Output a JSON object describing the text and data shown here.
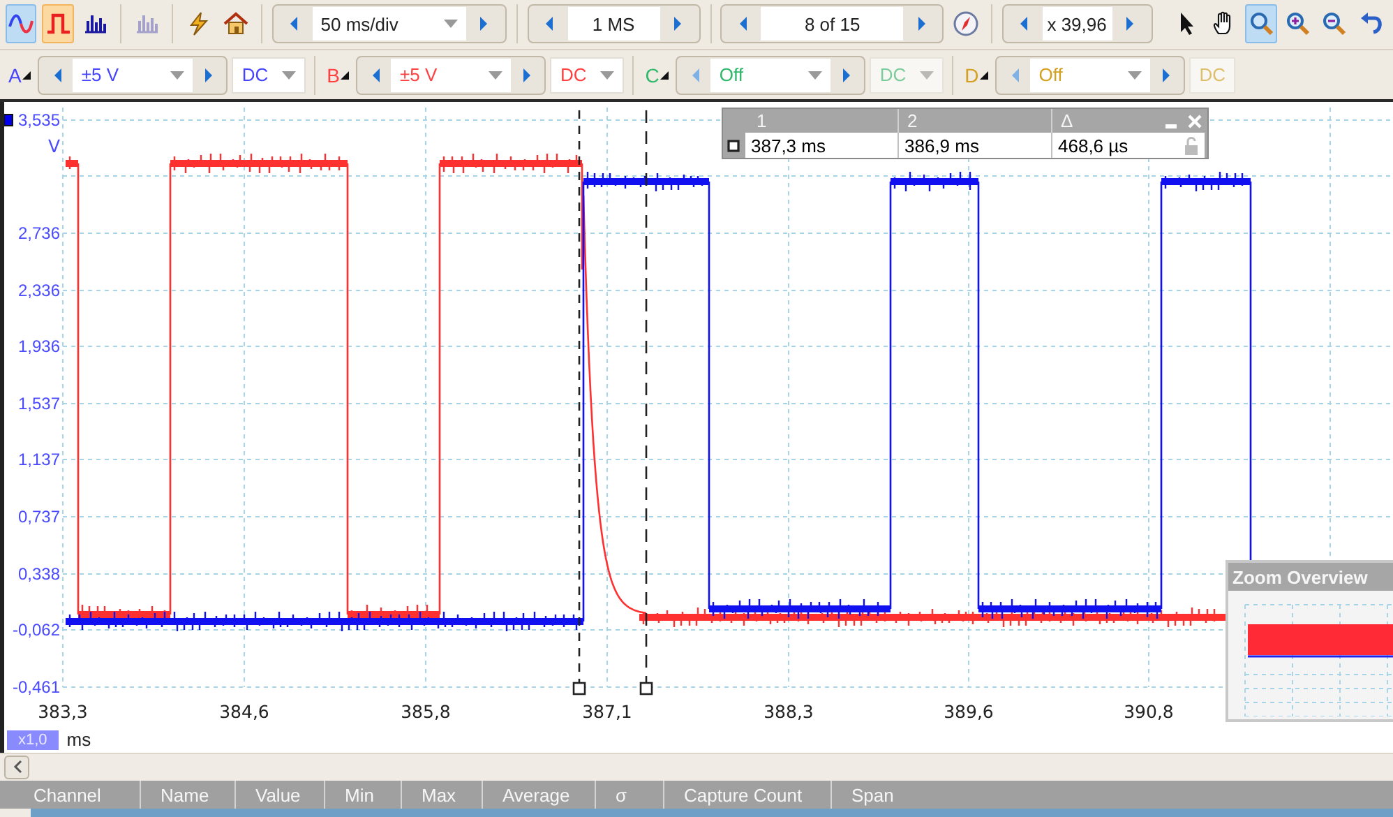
{
  "toolbar": {
    "modes": [
      {
        "kind": "scope",
        "selected": true,
        "disabled": false
      },
      {
        "kind": "persistence",
        "selected": true,
        "disabled": false
      },
      {
        "kind": "spectrum",
        "selected": false,
        "disabled": false
      },
      {
        "kind": "spectrum",
        "selected": false,
        "disabled": true
      }
    ],
    "actions": [
      {
        "kind": "trigger"
      },
      {
        "kind": "home"
      }
    ],
    "timebase": {
      "value": "50 ms/div"
    },
    "samples": {
      "value": "1 MS"
    },
    "buffer": {
      "value": "8 of 15"
    },
    "zoom_factor": {
      "value": "x 39,96"
    },
    "tools": [
      {
        "kind": "pointer",
        "selected": false
      },
      {
        "kind": "hand",
        "selected": false
      },
      {
        "kind": "zoom",
        "selected": true
      },
      {
        "kind": "zoom_in",
        "selected": false
      },
      {
        "kind": "zoom_out",
        "selected": false
      },
      {
        "kind": "undo",
        "selected": false
      }
    ]
  },
  "channels": [
    {
      "letter": "A",
      "color": "#4444ff",
      "range": "±5 V",
      "coupling": "DC",
      "enabled": true
    },
    {
      "letter": "B",
      "color": "#ff4040",
      "range": "±5 V",
      "coupling": "DC",
      "enabled": true
    },
    {
      "letter": "C",
      "color": "#2fb86a",
      "range": "Off",
      "coupling": "DC",
      "enabled": false
    },
    {
      "letter": "D",
      "color": "#d4a020",
      "range": "Off",
      "coupling": "DC",
      "enabled": false
    }
  ],
  "plot": {
    "y_unit": "V",
    "y_ticks": [
      "3,535",
      "2,736",
      "2,336",
      "1,936",
      "1,537",
      "1,137",
      "0,737",
      "0,338",
      "-0,062",
      "-0,461"
    ],
    "x_ticks": [
      "383,3",
      "384,6",
      "385,8",
      "387,1",
      "388,3",
      "389,6",
      "390,8"
    ],
    "x_unit": "ms",
    "x_scale": "x1,0"
  },
  "cursor_table": {
    "headers": [
      "1",
      "2",
      "Δ"
    ],
    "values": [
      "387,3 ms",
      "386,9 ms",
      "468,6 µs"
    ],
    "locked": false
  },
  "zoom_overview": {
    "title": "Zoom Overview"
  },
  "measurements": {
    "columns": [
      "Channel",
      "Name",
      "Value",
      "Min",
      "Max",
      "Average",
      "σ",
      "Capture Count",
      "Span"
    ]
  }
}
